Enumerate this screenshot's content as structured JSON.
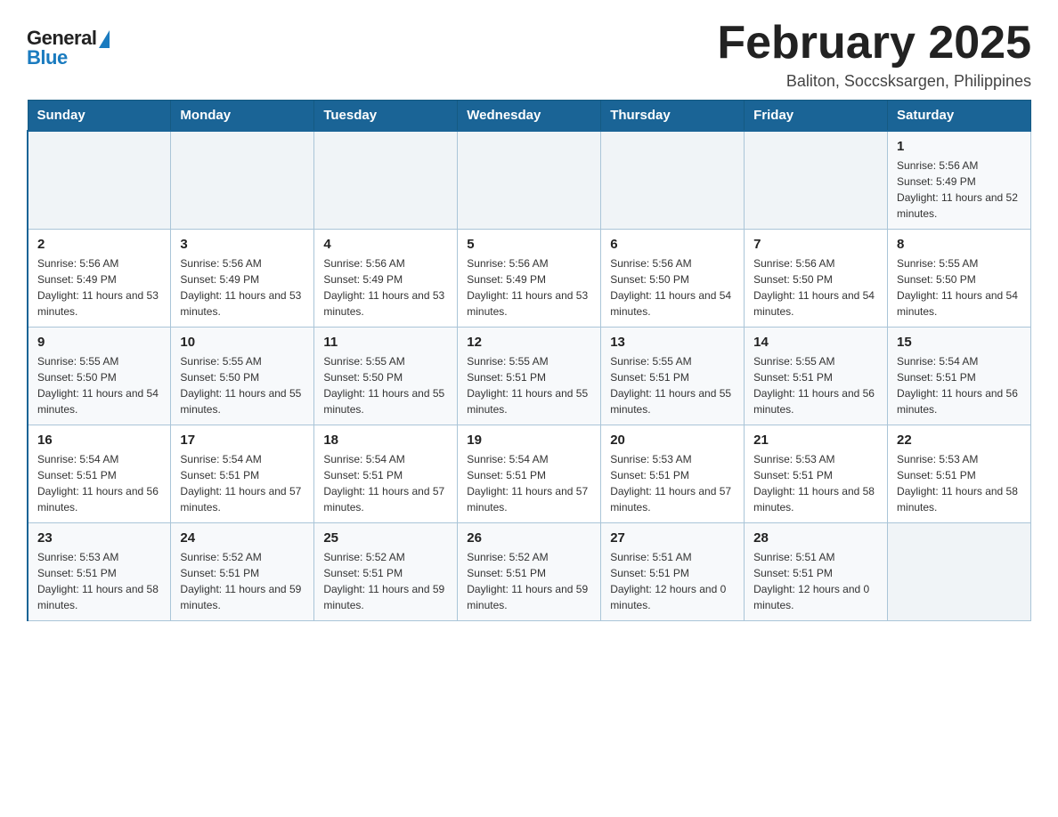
{
  "logo": {
    "general": "General",
    "blue": "Blue"
  },
  "header": {
    "month_title": "February 2025",
    "subtitle": "Baliton, Soccsksargen, Philippines"
  },
  "weekdays": [
    "Sunday",
    "Monday",
    "Tuesday",
    "Wednesday",
    "Thursday",
    "Friday",
    "Saturday"
  ],
  "weeks": [
    [
      {
        "day": "",
        "sunrise": "",
        "sunset": "",
        "daylight": ""
      },
      {
        "day": "",
        "sunrise": "",
        "sunset": "",
        "daylight": ""
      },
      {
        "day": "",
        "sunrise": "",
        "sunset": "",
        "daylight": ""
      },
      {
        "day": "",
        "sunrise": "",
        "sunset": "",
        "daylight": ""
      },
      {
        "day": "",
        "sunrise": "",
        "sunset": "",
        "daylight": ""
      },
      {
        "day": "",
        "sunrise": "",
        "sunset": "",
        "daylight": ""
      },
      {
        "day": "1",
        "sunrise": "Sunrise: 5:56 AM",
        "sunset": "Sunset: 5:49 PM",
        "daylight": "Daylight: 11 hours and 52 minutes."
      }
    ],
    [
      {
        "day": "2",
        "sunrise": "Sunrise: 5:56 AM",
        "sunset": "Sunset: 5:49 PM",
        "daylight": "Daylight: 11 hours and 53 minutes."
      },
      {
        "day": "3",
        "sunrise": "Sunrise: 5:56 AM",
        "sunset": "Sunset: 5:49 PM",
        "daylight": "Daylight: 11 hours and 53 minutes."
      },
      {
        "day": "4",
        "sunrise": "Sunrise: 5:56 AM",
        "sunset": "Sunset: 5:49 PM",
        "daylight": "Daylight: 11 hours and 53 minutes."
      },
      {
        "day": "5",
        "sunrise": "Sunrise: 5:56 AM",
        "sunset": "Sunset: 5:49 PM",
        "daylight": "Daylight: 11 hours and 53 minutes."
      },
      {
        "day": "6",
        "sunrise": "Sunrise: 5:56 AM",
        "sunset": "Sunset: 5:50 PM",
        "daylight": "Daylight: 11 hours and 54 minutes."
      },
      {
        "day": "7",
        "sunrise": "Sunrise: 5:56 AM",
        "sunset": "Sunset: 5:50 PM",
        "daylight": "Daylight: 11 hours and 54 minutes."
      },
      {
        "day": "8",
        "sunrise": "Sunrise: 5:55 AM",
        "sunset": "Sunset: 5:50 PM",
        "daylight": "Daylight: 11 hours and 54 minutes."
      }
    ],
    [
      {
        "day": "9",
        "sunrise": "Sunrise: 5:55 AM",
        "sunset": "Sunset: 5:50 PM",
        "daylight": "Daylight: 11 hours and 54 minutes."
      },
      {
        "day": "10",
        "sunrise": "Sunrise: 5:55 AM",
        "sunset": "Sunset: 5:50 PM",
        "daylight": "Daylight: 11 hours and 55 minutes."
      },
      {
        "day": "11",
        "sunrise": "Sunrise: 5:55 AM",
        "sunset": "Sunset: 5:50 PM",
        "daylight": "Daylight: 11 hours and 55 minutes."
      },
      {
        "day": "12",
        "sunrise": "Sunrise: 5:55 AM",
        "sunset": "Sunset: 5:51 PM",
        "daylight": "Daylight: 11 hours and 55 minutes."
      },
      {
        "day": "13",
        "sunrise": "Sunrise: 5:55 AM",
        "sunset": "Sunset: 5:51 PM",
        "daylight": "Daylight: 11 hours and 55 minutes."
      },
      {
        "day": "14",
        "sunrise": "Sunrise: 5:55 AM",
        "sunset": "Sunset: 5:51 PM",
        "daylight": "Daylight: 11 hours and 56 minutes."
      },
      {
        "day": "15",
        "sunrise": "Sunrise: 5:54 AM",
        "sunset": "Sunset: 5:51 PM",
        "daylight": "Daylight: 11 hours and 56 minutes."
      }
    ],
    [
      {
        "day": "16",
        "sunrise": "Sunrise: 5:54 AM",
        "sunset": "Sunset: 5:51 PM",
        "daylight": "Daylight: 11 hours and 56 minutes."
      },
      {
        "day": "17",
        "sunrise": "Sunrise: 5:54 AM",
        "sunset": "Sunset: 5:51 PM",
        "daylight": "Daylight: 11 hours and 57 minutes."
      },
      {
        "day": "18",
        "sunrise": "Sunrise: 5:54 AM",
        "sunset": "Sunset: 5:51 PM",
        "daylight": "Daylight: 11 hours and 57 minutes."
      },
      {
        "day": "19",
        "sunrise": "Sunrise: 5:54 AM",
        "sunset": "Sunset: 5:51 PM",
        "daylight": "Daylight: 11 hours and 57 minutes."
      },
      {
        "day": "20",
        "sunrise": "Sunrise: 5:53 AM",
        "sunset": "Sunset: 5:51 PM",
        "daylight": "Daylight: 11 hours and 57 minutes."
      },
      {
        "day": "21",
        "sunrise": "Sunrise: 5:53 AM",
        "sunset": "Sunset: 5:51 PM",
        "daylight": "Daylight: 11 hours and 58 minutes."
      },
      {
        "day": "22",
        "sunrise": "Sunrise: 5:53 AM",
        "sunset": "Sunset: 5:51 PM",
        "daylight": "Daylight: 11 hours and 58 minutes."
      }
    ],
    [
      {
        "day": "23",
        "sunrise": "Sunrise: 5:53 AM",
        "sunset": "Sunset: 5:51 PM",
        "daylight": "Daylight: 11 hours and 58 minutes."
      },
      {
        "day": "24",
        "sunrise": "Sunrise: 5:52 AM",
        "sunset": "Sunset: 5:51 PM",
        "daylight": "Daylight: 11 hours and 59 minutes."
      },
      {
        "day": "25",
        "sunrise": "Sunrise: 5:52 AM",
        "sunset": "Sunset: 5:51 PM",
        "daylight": "Daylight: 11 hours and 59 minutes."
      },
      {
        "day": "26",
        "sunrise": "Sunrise: 5:52 AM",
        "sunset": "Sunset: 5:51 PM",
        "daylight": "Daylight: 11 hours and 59 minutes."
      },
      {
        "day": "27",
        "sunrise": "Sunrise: 5:51 AM",
        "sunset": "Sunset: 5:51 PM",
        "daylight": "Daylight: 12 hours and 0 minutes."
      },
      {
        "day": "28",
        "sunrise": "Sunrise: 5:51 AM",
        "sunset": "Sunset: 5:51 PM",
        "daylight": "Daylight: 12 hours and 0 minutes."
      },
      {
        "day": "",
        "sunrise": "",
        "sunset": "",
        "daylight": ""
      }
    ]
  ]
}
